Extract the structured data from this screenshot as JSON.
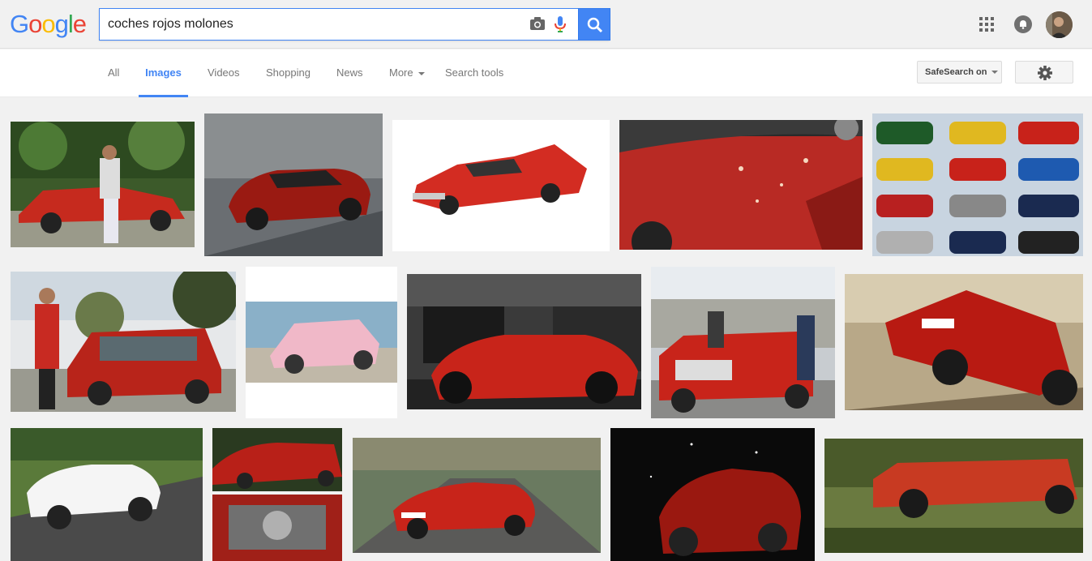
{
  "logo": {
    "letters": [
      "G",
      "o",
      "o",
      "g",
      "l",
      "e"
    ],
    "colors": [
      "#4285f4",
      "#ea4335",
      "#fbbc05",
      "#4285f4",
      "#34a853",
      "#ea4335"
    ]
  },
  "search": {
    "query": "coches rojos molones"
  },
  "nav": {
    "tabs": [
      "All",
      "Images",
      "Videos",
      "Shopping",
      "News",
      "More",
      "Search tools"
    ],
    "active": "Images",
    "safesearch": "SafeSearch on"
  },
  "colors": {
    "accent": "#4285f4"
  },
  "icons": [
    "camera-icon",
    "microphone-icon",
    "search-icon",
    "apps-grid-icon",
    "notifications-icon",
    "avatar",
    "gear-icon",
    "chevron-down-icon"
  ],
  "images": [
    {
      "desc": "red Ferrari with man"
    },
    {
      "desc": "red Bentley coupe"
    },
    {
      "desc": "red Cadillac toy"
    },
    {
      "desc": "red car hood"
    },
    {
      "desc": "grid of colored cars"
    },
    {
      "desc": "red Renault 4 with man"
    },
    {
      "desc": "pink toy Porsche"
    },
    {
      "desc": "red concept car"
    },
    {
      "desc": "Starsky and Hutch Torino"
    },
    {
      "desc": "red Ferrari F430"
    },
    {
      "desc": "white Ferrari"
    },
    {
      "desc": "red hot rod"
    },
    {
      "desc": "red Toyota GT86"
    },
    {
      "desc": "red Ferrari Enzo dark"
    },
    {
      "desc": "General Lee jumping"
    }
  ]
}
